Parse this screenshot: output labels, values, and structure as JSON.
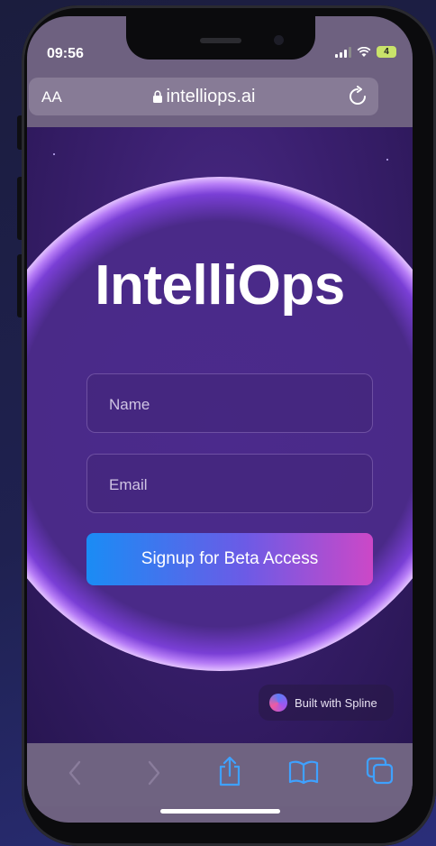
{
  "status": {
    "time": "09:56",
    "battery": "4"
  },
  "browser": {
    "text_size_label": "AA",
    "url": "intelliops.ai"
  },
  "page": {
    "title": "IntelliOps",
    "name_placeholder": "Name",
    "email_placeholder": "Email",
    "signup_label": "Signup for Beta Access",
    "badge_label": "Built with Spline"
  },
  "toolbar": {
    "items": [
      "back-icon",
      "forward-icon",
      "share-icon",
      "bookmarks-icon",
      "tabs-icon"
    ]
  },
  "colors": {
    "accent_blue": "#1a8cf5",
    "accent_pink": "#cc48c7",
    "page_bg": "#3a1f6e",
    "battery": "#c9e36a"
  }
}
